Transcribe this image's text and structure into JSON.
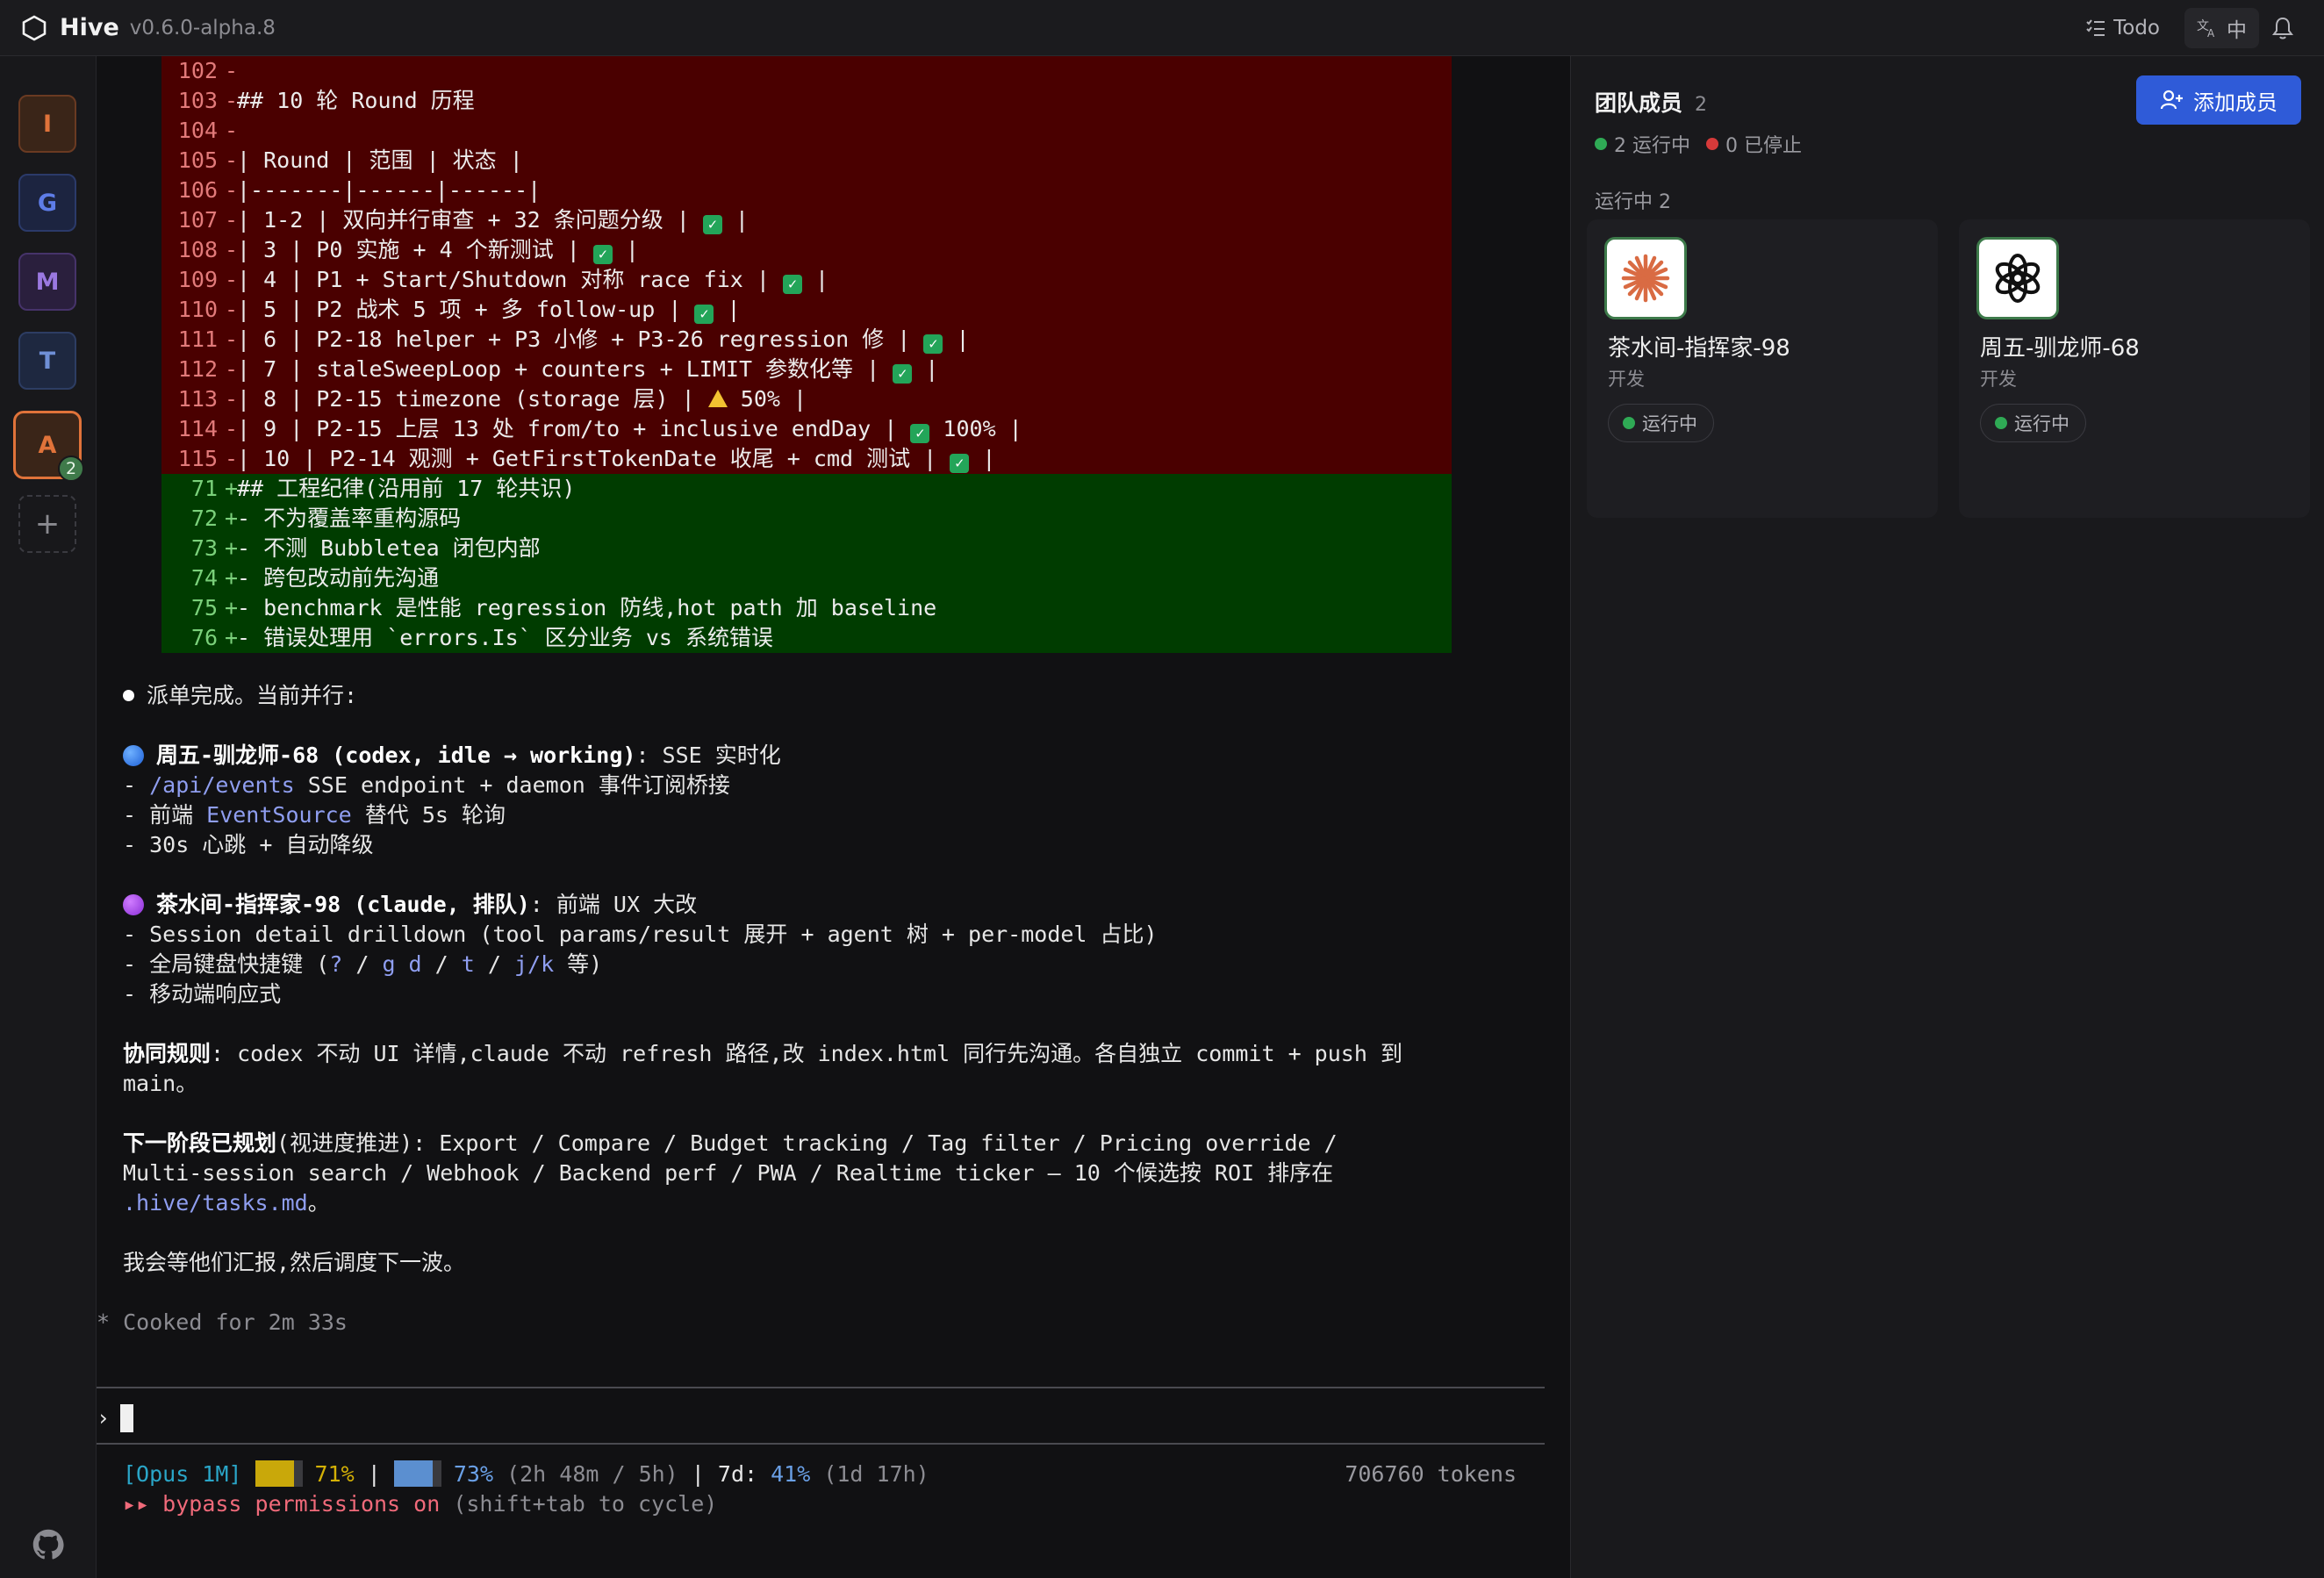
{
  "app": {
    "name": "Hive",
    "version": "v0.6.0-alpha.8"
  },
  "topbar": {
    "todo_label": "Todo",
    "lang_label": "中"
  },
  "rail": {
    "avatars": [
      {
        "letter": "I"
      },
      {
        "letter": "G"
      },
      {
        "letter": "M"
      },
      {
        "letter": "T"
      },
      {
        "letter": "A",
        "badge": "2"
      }
    ],
    "add_label": "+"
  },
  "diff": [
    {
      "type": "del",
      "num": "102",
      "sign": "-",
      "text": ""
    },
    {
      "type": "del",
      "num": "103",
      "sign": "-",
      "text": "## 10 轮 Round 历程"
    },
    {
      "type": "del",
      "num": "104",
      "sign": "-",
      "text": ""
    },
    {
      "type": "del",
      "num": "105",
      "sign": "-",
      "text": "| Round | 范围 | 状态 |"
    },
    {
      "type": "del",
      "num": "106",
      "sign": "-",
      "text": "|-------|------|------|"
    },
    {
      "type": "del",
      "num": "107",
      "sign": "-",
      "text": "| 1-2 | 双向并行审查 + 32 条问题分级 | ",
      "mark": "check",
      "tail": " |"
    },
    {
      "type": "del",
      "num": "108",
      "sign": "-",
      "text": "| 3 | P0 实施 + 4 个新测试 | ",
      "mark": "check",
      "tail": " |"
    },
    {
      "type": "del",
      "num": "109",
      "sign": "-",
      "text": "| 4 | P1 + Start/Shutdown 对称 race fix | ",
      "mark": "check",
      "tail": " |"
    },
    {
      "type": "del",
      "num": "110",
      "sign": "-",
      "text": "| 5 | P2 战术 5 项 + 多 follow-up | ",
      "mark": "check",
      "tail": " |"
    },
    {
      "type": "del",
      "num": "111",
      "sign": "-",
      "text": "| 6 | P2-18 helper + P3 小修 + P3-26 regression 修 | ",
      "mark": "check",
      "tail": " |"
    },
    {
      "type": "del",
      "num": "112",
      "sign": "-",
      "text": "| 7 | staleSweepLoop + counters + LIMIT 参数化等 | ",
      "mark": "check",
      "tail": " |"
    },
    {
      "type": "del",
      "num": "113",
      "sign": "-",
      "text": "| 8 | P2-15 timezone (storage 层) | ",
      "mark": "warn",
      "tail": " 50% |"
    },
    {
      "type": "del",
      "num": "114",
      "sign": "-",
      "text": "| 9 | P2-15 上层 13 处 from/to + inclusive endDay | ",
      "mark": "check",
      "tail": " 100% |"
    },
    {
      "type": "del",
      "num": "115",
      "sign": "-",
      "text": "| 10 | P2-14 观测 + GetFirstTokenDate 收尾 + cmd 测试 | ",
      "mark": "check",
      "tail": " |"
    },
    {
      "type": "add",
      "num": "71",
      "sign": "+",
      "text": "## 工程纪律(沿用前 17 轮共识)"
    },
    {
      "type": "add",
      "num": "72",
      "sign": "+",
      "text": "- 不为覆盖率重构源码"
    },
    {
      "type": "add",
      "num": "73",
      "sign": "+",
      "text": "- 不测 Bubbletea 闭包内部"
    },
    {
      "type": "add",
      "num": "74",
      "sign": "+",
      "text": "- 跨包改动前先沟通"
    },
    {
      "type": "add",
      "num": "75",
      "sign": "+",
      "text": "- benchmark 是性能 regression 防线,hot path 加 baseline"
    },
    {
      "type": "add",
      "num": "76",
      "sign": "+",
      "text": "- 错误处理用 `errors.Is` 区分业务 vs 系统错误"
    }
  ],
  "message": {
    "intro": "派单完成。当前并行:",
    "agent1": {
      "title": "周五-驯龙师-68 (codex, idle → working)",
      "task": ": SSE 实时化",
      "l1_link": "/api/events",
      "l1_text": " SSE endpoint + daemon 事件订阅桥接",
      "l2_pre": "- 前端 ",
      "l2_link": "EventSource",
      "l2_post": " 替代 5s 轮询",
      "l3": "- 30s 心跳 + 自动降级"
    },
    "agent2": {
      "title": "茶水间-指挥家-98 (claude, 排队)",
      "task": ": 前端 UX 大改",
      "l1": "- Session detail drilldown (tool params/result 展开 + agent 树 + per-model 占比)",
      "l2_pre": "- 全局键盘快捷键 (",
      "k1": "?",
      "k2": "g d",
      "k3": "t",
      "k4": "j/k",
      "l2_post": " 等)",
      "l3": "- 移动端响应式"
    },
    "rule_label": "协同规则",
    "rule_line1": ": codex 不动 UI 详情,claude 不动 refresh 路径,改 index.html 同行先沟通。各自独立 commit + push 到",
    "rule_line2": "main。",
    "next_label": "下一阶段已规划",
    "next_line1": "(视进度推进): Export / Compare / Budget tracking / Tag filter / Pricing override /",
    "next_line2": "Multi-session search / Webhook / Backend perf / PWA / Realtime ticker — 10 个候选按 ROI 排序在",
    "next_link": ".hive/tasks.md",
    "next_end": "。",
    "closing": "我会等他们汇报,然后调度下一波。",
    "cooked": "* Cooked for 2m 33s"
  },
  "statusbar": {
    "model": "[Opus 1M]",
    "ctx_pct": "71%",
    "session_pct": "73%",
    "session_detail": "(2h 48m / 5h)",
    "week_label": "7d:",
    "week_pct": "41%",
    "week_detail": "(1d 17h)",
    "tokens": "706760 tokens",
    "perm_arrow": "▸▸",
    "perm_text": "bypass permissions on",
    "perm_hint": "(shift+tab to cycle)"
  },
  "panel": {
    "title": "团队成员",
    "count": "2",
    "running_stat": "2 运行中",
    "stopped_stat": "0 已停止",
    "add_button": "添加成员",
    "running_section": "运行中 2",
    "members": [
      {
        "name": "茶水间-指挥家-98",
        "role": "开发",
        "status": "运行中",
        "icon": "claude-icon"
      },
      {
        "name": "周五-驯龙师-68",
        "role": "开发",
        "status": "运行中",
        "icon": "openai-icon"
      }
    ]
  },
  "colors": {
    "accent": "#2f5bd8",
    "running": "#2faa55",
    "stopped": "#d63a3a",
    "diff_del": "#4a0000",
    "diff_add": "#003c00"
  }
}
